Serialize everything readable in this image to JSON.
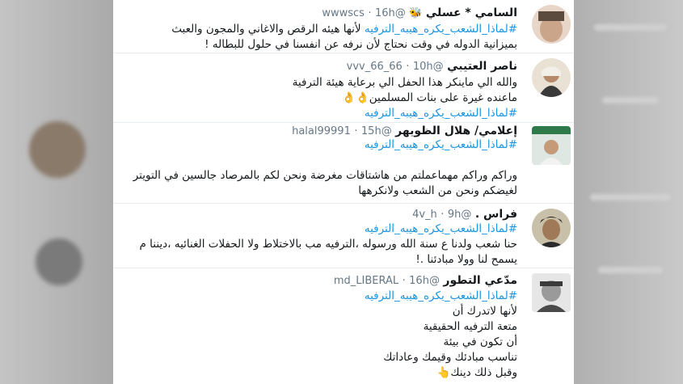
{
  "tweets": [
    {
      "name": "السامي * عسلي",
      "badge_icon": "bee-icon",
      "handle": "@wwwscs",
      "dot": "·",
      "time": "16h",
      "lines": [
        {
          "hashtag": "#لماذا_الشعب_يكره_هيبه_الترفيه",
          "text": " لأنها هيئه الرقص والاغاني والمجون والعبث"
        },
        {
          "text": "بميزانية الدوله في وقت نحتاج لأن نرفه عن انفسنا في حلول للبطاله !"
        }
      ]
    },
    {
      "name": "ناصر العتيبي",
      "handle": "@vvv_66_66",
      "dot": "·",
      "time": "10h",
      "lines": [
        {
          "text": "والله الي ماينكر هذا الحفل الي برعاية هيئة الترفية"
        },
        {
          "text": "ماعنده غيرة على بنات المسلمين",
          "emoji": "👌👌"
        },
        {
          "hashtag": "#لماذا_الشعب_يكره_هيبه_الترفيه"
        }
      ]
    },
    {
      "name": "إعلامي/ هلال الظويهر",
      "handle": "@halal99991",
      "dot": "·",
      "time": "15h",
      "lines": [
        {
          "hashtag": "#لماذا_الشعب_يكره_هيبه_الترفيه"
        },
        {
          "text": ""
        },
        {
          "text": "وراكم وراكم مهماعملتم من هاشتاقات مغرضة ونحن لكم بالمرصاد جالسين في التويتر"
        },
        {
          "text": "لغيضكم ونحن من الشعب ولانكرهها"
        }
      ]
    },
    {
      "name": "فراس .",
      "handle": "@4v_h",
      "dot": "·",
      "time": "9h",
      "lines": [
        {
          "hashtag": "#لماذا_الشعب_يكره_هيبه_الترفيه"
        },
        {
          "text": "حنا شعب ولدنا ع سنة الله ورسوله ،الترفيه مب بالاختلاط ولا الحفلات الغنائيه ،ديننا م"
        },
        {
          "text": "يسمح لنا وولا مبادئنا .!"
        }
      ]
    },
    {
      "name": "مدّعي التطور",
      "handle": "@md_LIBERAL",
      "dot": "·",
      "time": "16h",
      "lines": [
        {
          "hashtag": "#لماذا_الشعب_يكره_هيبه_الترفيه"
        },
        {
          "text": "لأنها لاتدرك أن"
        },
        {
          "text": "متعة الترفيه الحقيقية"
        },
        {
          "text": "أن تكون في بيئة"
        },
        {
          "text": "تناسب مبادئك وقيمك وعاداتك"
        },
        {
          "text": "وقبل ذلك دينك",
          "emoji": "👆"
        }
      ]
    }
  ],
  "colors": {
    "hashtag": "#1b95e0",
    "name": "#14171a",
    "meta": "#657786"
  }
}
